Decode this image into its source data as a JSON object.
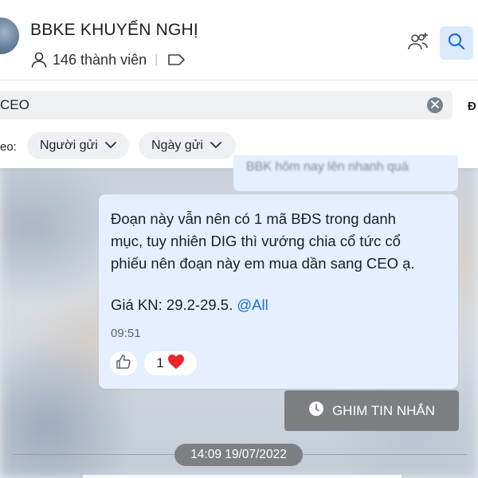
{
  "header": {
    "group_name": "BBKE KHUYẾN NGHỊ",
    "member_count": "146 thành viên",
    "separator": "|"
  },
  "search": {
    "query": "CEO",
    "cut_off_label": "Đ",
    "filter_prefix": "eo:",
    "filters": {
      "sender_label": "Người gửi",
      "date_label": "Ngày gửi"
    }
  },
  "messages": {
    "previous_snippet": "BBK hôm nay lên nhanh quá",
    "current": {
      "line1": "Đoạn này vẫn nên có 1 mã BĐS trong danh",
      "line2": "mục, tuy nhiên DIG thì vướng chia cổ tức cổ",
      "line3": "phiếu nên đoạn này em mua dần sang CEO ạ.",
      "price_text": "Giá KN: 29.2-29.5. ",
      "mention": "@All",
      "time": "09:51",
      "reaction_count": "1",
      "reaction_emoji": "❤️"
    }
  },
  "pin_button": {
    "label": "GHIM TIN NHẮN"
  },
  "date_divider": {
    "label": "14:09 19/07/2022"
  },
  "colors": {
    "accent": "#1a6fe0",
    "bubble": "#e5efff",
    "pin_bg": "#7d7f83",
    "search_btn_bg": "#dbe9fd"
  },
  "icons": {
    "members": "person-icon",
    "tag": "tag-icon",
    "add_member": "add-member-icon",
    "search": "search-icon",
    "clear": "close-icon",
    "chevron": "chevron-down-icon",
    "like": "thumbs-up-icon",
    "heart": "heart-icon",
    "clock": "clock-icon"
  }
}
